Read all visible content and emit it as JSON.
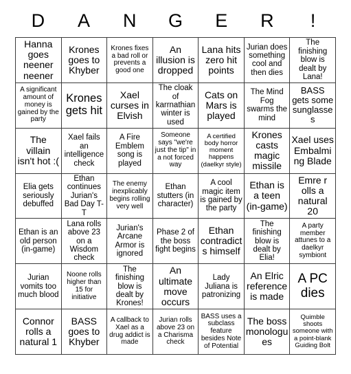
{
  "card": {
    "title_letters": [
      "D",
      "A",
      "N",
      "G",
      "E",
      "R",
      "!"
    ],
    "columns": 7,
    "rows": 7,
    "border_color": "#3a3a3a",
    "background_color": "#ffffff",
    "text_color": "#000000",
    "cells": [
      "Hanna goes neener neener",
      "Krones goes to Khyber",
      "Krones fixes a bad roll or prevents a good one",
      "An illusion is dropped",
      "Lana hits zero hit points",
      "Jurian does something cool and then dies",
      "The finishing blow is dealt by Lana!",
      "A significant amount of money is gained by the party",
      "Krones gets hit",
      "Xael curses in Elvish",
      "The cloak of karrnathian winter is used",
      "Cats on Mars is played",
      "The Mind Fog swarms the mind",
      "BASS gets some sunglasses",
      "The villain isn't hot :(",
      "Xael fails an intelligence check",
      "A Fire Emblem song is played",
      "Someone says \"we're just the tip\" in a not forced way",
      "A certified body horror moment happens (daelkyr style)",
      "Krones casts magic missile",
      "Xael uses Embalming Blade",
      "Elia gets seriously debuffed",
      "Ethan continues Jurian's Bad Day T-T",
      "The enemy inexplicably begins rolling very well",
      "Ethan stutters (in character)",
      "A cool magic item is gained by the party",
      "Ethan is a teen (in-game)",
      "Emre r olls a natural 20",
      "Ethan is an old person (in-game)",
      "Lana rolls above 23 on a Wisdom check",
      "Jurian's Arcane Armor is ignored",
      "Phase 2 of the boss fight begins",
      "Ethan contradicts himself",
      "The finishing blow is dealt by Elia!",
      "A party member attunes to a daelkyr symbiont",
      "Jurian vomits too much blood",
      "Noone rolls higher than 15 for initiative",
      "The finishing blow is dealt by Krones!",
      "An ultimate move occurs",
      "Lady Juliana is patronizing",
      "An Elric reference is made",
      "A PC dies",
      "Connor rolls a natural 1",
      "BASS goes to Khyber",
      "A callback to Xael as a drug addict is made",
      "Jurian rolls above 23 on a Charisma check",
      "BASS uses a subclass feature besides Note of Potential",
      "The boss monologues",
      "Quimble shoots someone with a point-blank Guiding Bolt"
    ]
  }
}
